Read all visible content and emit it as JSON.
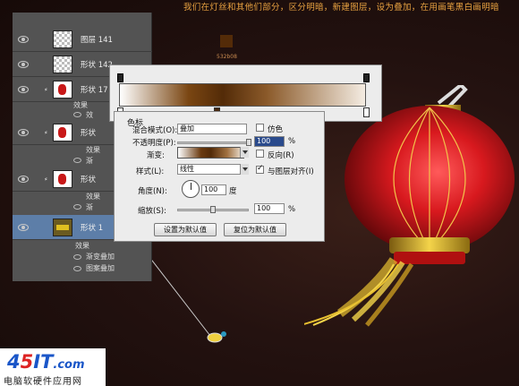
{
  "caption": "我们在灯丝和其他们部分，区分明暗，新建图层，设为叠加，在用画笔黑白画明暗",
  "swatch": {
    "color": "#532b08",
    "hex_label": "532b08"
  },
  "layers": {
    "rows": [
      {
        "name": "图层 141",
        "thumb": "transparent",
        "fx": false
      },
      {
        "name": "形状 142",
        "thumb": "transparent",
        "fx": false
      },
      {
        "name": "形状 17",
        "thumb": "shape",
        "fx": true
      },
      {
        "name": "形状",
        "thumb": "shape",
        "fx": true
      },
      {
        "name": "形状",
        "thumb": "shape",
        "fx": true
      },
      {
        "name": "形状 1",
        "thumb": "gold",
        "fx": false,
        "selected": true
      }
    ],
    "sub_items": {
      "effects": "效果",
      "short_a": "效",
      "short_b": "渐",
      "gradient_overlay": "渐变叠加",
      "pattern_overlay": "图案叠加"
    }
  },
  "gradient_editor": {
    "colors": {
      "start": "#ffffff",
      "mid": "#532b08",
      "end": "#f4ece2"
    }
  },
  "layer_style": {
    "group_title": "色标",
    "blend_mode_label": "混合模式(O):",
    "blend_mode_value": "叠加",
    "dither_label": "仿色",
    "opacity_label": "不透明度(P):",
    "opacity_value": "100",
    "percent": "%",
    "gradient_label": "渐变:",
    "reverse_label": "反向(R)",
    "style_label": "样式(L):",
    "style_value": "线性",
    "align_label": "与图层对齐(I)",
    "angle_label": "角度(N):",
    "angle_value": "100",
    "degree": "度",
    "scale_label": "缩放(S):",
    "scale_value": "100",
    "reset_default": "设置为默认值",
    "restore_default": "复位为默认值",
    "opacity_level": 1.0,
    "scale_level": 0.5
  },
  "watermark": {
    "logo_a": "4",
    "logo_b": "5",
    "logo_c": "IT",
    "logo_d": ".com",
    "subtitle": "电脑软硬件应用网"
  }
}
